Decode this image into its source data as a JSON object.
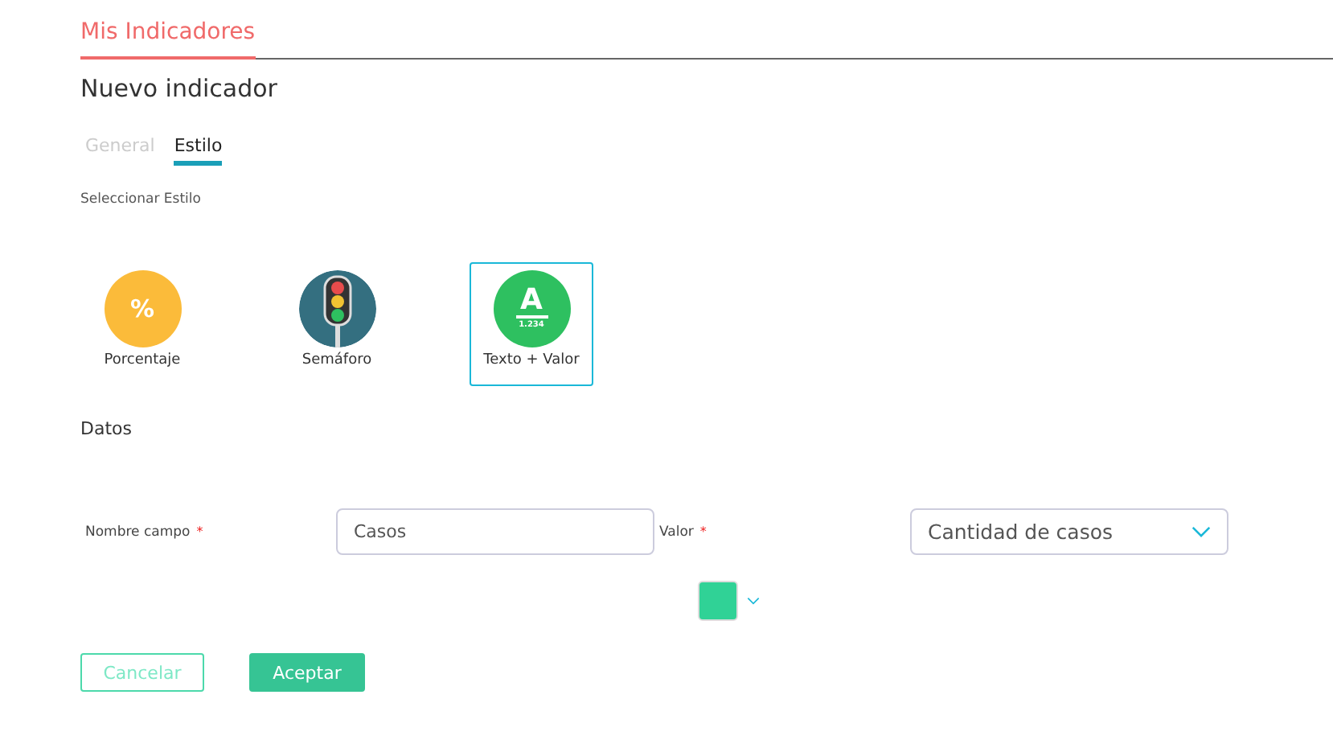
{
  "header_tab": {
    "label": "Mis Indicadores",
    "selected": true
  },
  "title": "Nuevo indicador",
  "tabs": [
    {
      "label": "General",
      "selected": false
    },
    {
      "label": "Estilo",
      "selected": true
    }
  ],
  "style_section": {
    "label": "Seleccionar Estilo"
  },
  "styles": [
    {
      "kind": "percent",
      "glyph": "%",
      "label": "Porcentaje",
      "selected": false
    },
    {
      "kind": "traffic",
      "label": "Semáforo",
      "selected": false
    },
    {
      "kind": "text",
      "glyph": "A",
      "sub": "1.234",
      "label": "Texto + Valor",
      "selected": true
    }
  ],
  "data_section": {
    "label": "Datos"
  },
  "fields": [
    {
      "label": "Nombre campo",
      "required_mark": "*",
      "kind": "input",
      "value": "Casos"
    },
    {
      "label": "Valor",
      "required_mark": "*",
      "kind": "select",
      "value": "Cantidad de casos"
    }
  ],
  "color_picker": {
    "color": "#30d296"
  },
  "buttons": [
    {
      "label": "Cancelar",
      "kind": "secondary"
    },
    {
      "label": "Aceptar",
      "kind": "primary"
    }
  ]
}
